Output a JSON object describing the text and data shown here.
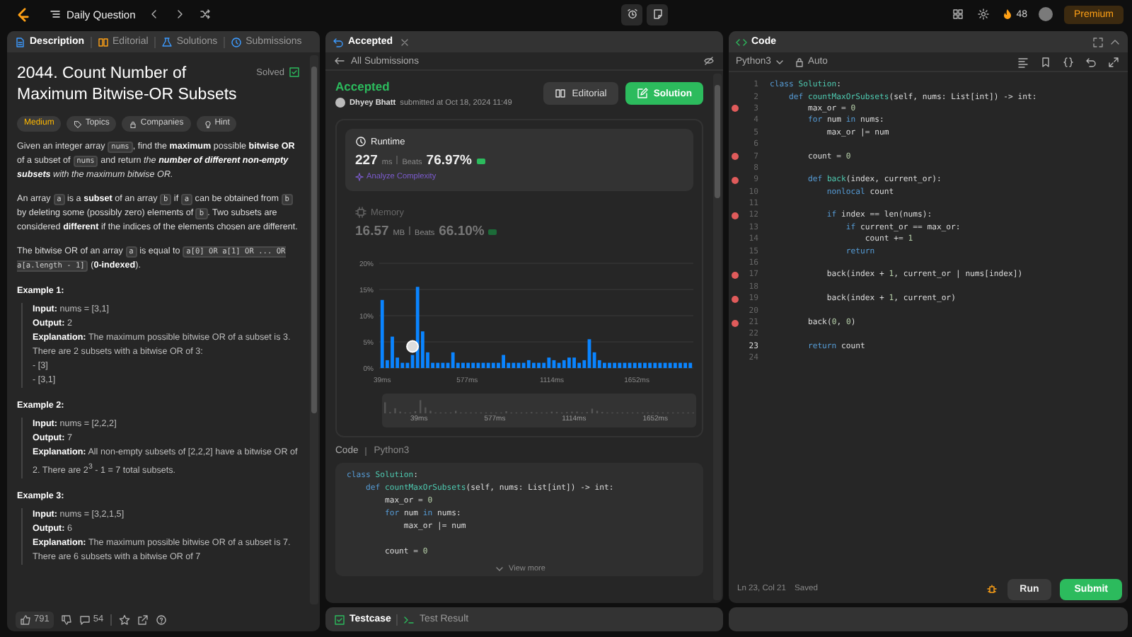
{
  "top_bar": {
    "title": "Daily Question",
    "streak": "48",
    "premium": "Premium"
  },
  "description_panel": {
    "tabs": [
      {
        "label": "Description",
        "selected": true
      },
      {
        "label": "Editorial",
        "selected": false
      },
      {
        "label": "Solutions",
        "selected": false
      },
      {
        "label": "Submissions",
        "selected": false
      }
    ],
    "title": "2044. Count Number of Maximum Bitwise-OR Subsets",
    "status": "Solved",
    "difficulty": "Medium",
    "tags": [
      "Topics",
      "Companies",
      "Hint"
    ],
    "paragraphs": [
      [
        {
          "text": "Given an integer array ",
          "kind": "plain"
        },
        {
          "text": "nums",
          "kind": "code"
        },
        {
          "text": ", find the ",
          "kind": "plain"
        },
        {
          "text": "maximum",
          "kind": "bold"
        },
        {
          "text": " possible ",
          "kind": "plain"
        },
        {
          "text": "bitwise OR",
          "kind": "bold"
        },
        {
          "text": " of a subset of ",
          "kind": "plain"
        },
        {
          "text": "nums",
          "kind": "code"
        },
        {
          "text": " and return ",
          "kind": "plain"
        },
        {
          "text": "the ",
          "kind": "italic"
        },
        {
          "text": "number of different non-empty subsets",
          "kind": "bolditalic"
        },
        {
          "text": " with the maximum bitwise OR.",
          "kind": "italic"
        }
      ],
      [
        {
          "text": "An array ",
          "kind": "plain"
        },
        {
          "text": "a",
          "kind": "code"
        },
        {
          "text": " is a ",
          "kind": "plain"
        },
        {
          "text": "subset",
          "kind": "bold"
        },
        {
          "text": " of an array ",
          "kind": "plain"
        },
        {
          "text": "b",
          "kind": "code"
        },
        {
          "text": " if ",
          "kind": "plain"
        },
        {
          "text": "a",
          "kind": "code"
        },
        {
          "text": " can be obtained from ",
          "kind": "plain"
        },
        {
          "text": "b",
          "kind": "code"
        },
        {
          "text": " by deleting some (possibly zero) elements of ",
          "kind": "plain"
        },
        {
          "text": "b",
          "kind": "code"
        },
        {
          "text": ". Two subsets are considered ",
          "kind": "plain"
        },
        {
          "text": "different",
          "kind": "bold"
        },
        {
          "text": " if the indices of the elements chosen are different.",
          "kind": "plain"
        }
      ],
      [
        {
          "text": "The bitwise OR of an array ",
          "kind": "plain"
        },
        {
          "text": "a",
          "kind": "code"
        },
        {
          "text": " is equal to ",
          "kind": "plain"
        },
        {
          "text": "a[0] OR a[1] OR ... OR a[a.length - 1]",
          "kind": "code"
        },
        {
          "text": " (",
          "kind": "plain"
        },
        {
          "text": "0-indexed",
          "kind": "bold"
        },
        {
          "text": ").",
          "kind": "plain"
        }
      ]
    ],
    "examples": [
      {
        "heading": "Example 1:",
        "lines": [
          {
            "label": "Input:",
            "text": "nums = [3,1]"
          },
          {
            "label": "Output:",
            "text": "2"
          },
          {
            "label": "Explanation:",
            "text": "The maximum possible bitwise OR of a subset is 3. There are 2 subsets with a bitwise OR of 3:"
          }
        ],
        "list": [
          "- [3]",
          "- [3,1]"
        ]
      },
      {
        "heading": "Example 2:",
        "lines": [
          {
            "label": "Input:",
            "text": "nums = [2,2,2]"
          },
          {
            "label": "Output:",
            "text": "7"
          },
          {
            "label": "Explanation:",
            "text": "All non-empty subsets of [2,2,2] have a bitwise OR of 2. There are 2$^{3}$ - 1 = 7 total subsets."
          }
        ]
      },
      {
        "heading": "Example 3:",
        "lines": [
          {
            "label": "Input:",
            "text": "nums = [3,2,1,5]"
          },
          {
            "label": "Output:",
            "text": "6"
          },
          {
            "label": "Explanation:",
            "text": "The maximum possible bitwise OR of a subset is 7. There are 6 subsets with a bitwise OR of 7"
          }
        ]
      }
    ],
    "footer": {
      "likes": "791",
      "comments": "54"
    }
  },
  "submission_panel": {
    "tab": "Accepted",
    "back": "All Submissions",
    "status": "Accepted",
    "author": "Dhyey Bhatt",
    "submitted": "submitted at Oct 18, 2024 11:49",
    "buttons": [
      "Editorial",
      "Solution"
    ],
    "runtime": {
      "label": "Runtime",
      "value": "227",
      "unit": "ms",
      "beats_label": "Beats",
      "beats": "76.97%",
      "link": "Analyze Complexity",
      "selected": true
    },
    "memory": {
      "label": "Memory",
      "value": "16.57",
      "unit": "MB",
      "beats_label": "Beats",
      "beats": "66.10%",
      "selected": false
    },
    "chart_data": {
      "type": "bar",
      "x": [
        39,
        71,
        103,
        135,
        167,
        199,
        231,
        263,
        295,
        327,
        359,
        391,
        423,
        455,
        487,
        519,
        551,
        583,
        615,
        647,
        679,
        711,
        743,
        775,
        807,
        839,
        871,
        903,
        935,
        967,
        999,
        1031,
        1063,
        1095,
        1127,
        1159,
        1191,
        1223,
        1255,
        1287,
        1319,
        1351,
        1383,
        1415,
        1447,
        1479,
        1511,
        1543,
        1575,
        1607,
        1639,
        1671,
        1703,
        1735,
        1767,
        1799,
        1831,
        1863,
        1895,
        1927,
        1959,
        1991
      ],
      "grid": true,
      "series": [
        {
          "color": "#0a84ff",
          "values": [
            13,
            1.5,
            6,
            2,
            1,
            1,
            2.5,
            15.5,
            7,
            3,
            1,
            1,
            1,
            1,
            3,
            1,
            1,
            1,
            1,
            1,
            1,
            1,
            1,
            1,
            2.5,
            1,
            1,
            1,
            1,
            1.5,
            1,
            1,
            1,
            2,
            1.5,
            1,
            1.5,
            2,
            2,
            1,
            1.5,
            5.5,
            3,
            1.5,
            1,
            1,
            1,
            1,
            1,
            1,
            1,
            1,
            1,
            1,
            1,
            1,
            1,
            1,
            1,
            1,
            1,
            1
          ]
        }
      ],
      "xlim": [
        20,
        2010
      ],
      "ylim": [
        0,
        20
      ],
      "xticks": [
        {
          "value": 39,
          "label": "39ms"
        },
        {
          "value": 577,
          "label": "577ms"
        },
        {
          "value": 1114,
          "label": "1114ms"
        },
        {
          "value": 1652,
          "label": "1652ms"
        }
      ],
      "yticks": [
        {
          "value": 0,
          "label": "0%"
        },
        {
          "value": 5,
          "label": "5%"
        },
        {
          "value": 10,
          "label": "10%"
        },
        {
          "value": 15,
          "label": "15%"
        },
        {
          "value": 20,
          "label": "20%"
        }
      ]
    },
    "overview_labels": [
      "39ms",
      "577ms",
      "1114ms",
      "1652ms"
    ],
    "code_tab": "Code",
    "code_language": "Python3",
    "code": "class Solution:\n    def countMaxOrSubsets(self, nums: List[int]) -> int:\n        max_or = 0\n        for num in nums:\n            max_or |= num\n\n        count = 0",
    "view_more": "View more"
  },
  "bottom_panel": {
    "tabs": [
      {
        "label": "Testcase",
        "selected": true
      },
      {
        "label": "Test Result",
        "selected": false
      }
    ]
  },
  "editor": {
    "title": "Code",
    "language": "Python3",
    "mode": "Auto",
    "lines": [
      {
        "number": "1",
        "text": "class Solution:",
        "breakpoint": false,
        "active": false
      },
      {
        "number": "2",
        "text": "    def countMaxOrSubsets(self, nums: List[int]) -> int:",
        "breakpoint": false,
        "active": false
      },
      {
        "number": "3",
        "text": "        max_or = 0",
        "breakpoint": true,
        "active": false
      },
      {
        "number": "4",
        "text": "        for num in nums:",
        "breakpoint": false,
        "active": false
      },
      {
        "number": "5",
        "text": "            max_or |= num",
        "breakpoint": false,
        "active": false
      },
      {
        "number": "6",
        "breakpoint": false,
        "active": false
      },
      {
        "number": "7",
        "text": "        count = 0",
        "breakpoint": true,
        "active": false
      },
      {
        "number": "8",
        "breakpoint": false,
        "active": false
      },
      {
        "number": "9",
        "text": "        def back(index, current_or):",
        "breakpoint": true,
        "active": false
      },
      {
        "number": "10",
        "text": "            nonlocal count",
        "breakpoint": false,
        "active": false
      },
      {
        "number": "11",
        "breakpoint": false,
        "active": false
      },
      {
        "number": "12",
        "text": "            if index == len(nums):",
        "breakpoint": true,
        "active": false
      },
      {
        "number": "13",
        "text": "                if current_or == max_or:",
        "breakpoint": false,
        "active": false
      },
      {
        "number": "14",
        "text": "                    count += 1",
        "breakpoint": false,
        "active": false
      },
      {
        "number": "15",
        "text": "                return",
        "breakpoint": false,
        "active": false
      },
      {
        "number": "16",
        "breakpoint": false,
        "active": false
      },
      {
        "number": "17",
        "text": "            back(index + 1, current_or | nums[index])",
        "breakpoint": true,
        "active": false
      },
      {
        "number": "18",
        "breakpoint": false,
        "active": false
      },
      {
        "number": "19",
        "text": "            back(index + 1, current_or)",
        "breakpoint": true,
        "active": false
      },
      {
        "number": "20",
        "breakpoint": false,
        "active": false
      },
      {
        "number": "21",
        "text": "        back(0, 0)",
        "breakpoint": true,
        "active": false
      },
      {
        "number": "22",
        "breakpoint": false,
        "active": false
      },
      {
        "number": "23",
        "text": "        return count",
        "breakpoint": false,
        "active": true
      },
      {
        "number": "24",
        "breakpoint": false,
        "active": false
      }
    ],
    "position": "Ln 23, Col 21",
    "save_state": "Saved",
    "buttons": [
      "Run",
      "Submit"
    ]
  }
}
